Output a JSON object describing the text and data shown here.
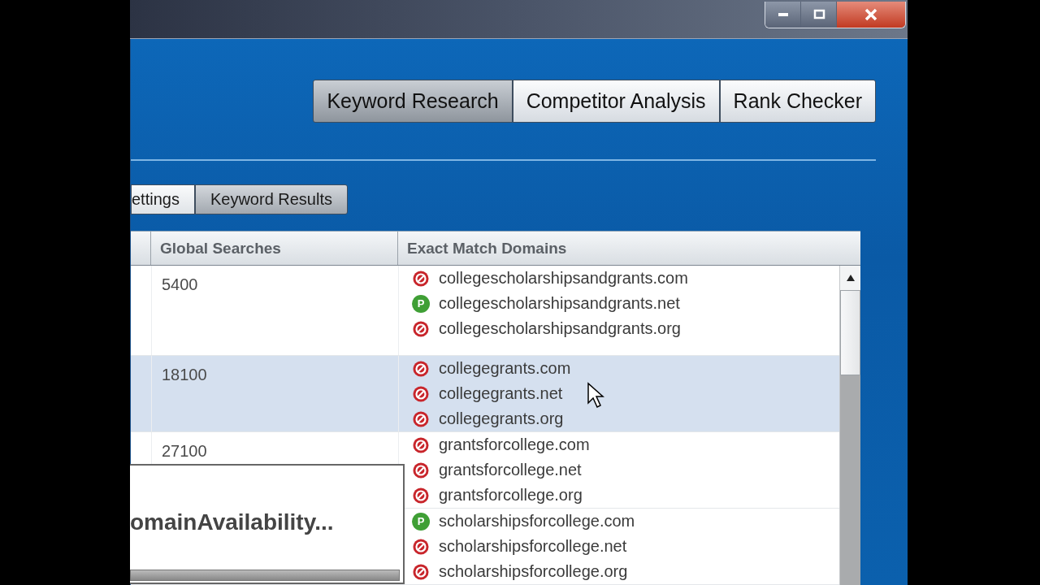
{
  "window": {
    "controls": [
      {
        "kind": "minimize"
      },
      {
        "kind": "maximize"
      },
      {
        "kind": "close"
      }
    ]
  },
  "tabs": [
    {
      "label": "Keyword Research",
      "selected": true
    },
    {
      "label": "Competitor Analysis",
      "selected": false
    },
    {
      "label": "Rank Checker",
      "selected": false
    }
  ],
  "subtabs": [
    {
      "label": "ettings",
      "selected": false
    },
    {
      "label": "Keyword Results",
      "selected": true
    }
  ],
  "table": {
    "columns": [
      "Global Searches",
      "Exact Match Domains"
    ],
    "rows": [
      {
        "selected": false,
        "searches": "5400",
        "domains": [
          {
            "name": "collegescholarshipsandgrants.com",
            "kind": "taken"
          },
          {
            "name": "collegescholarshipsandgrants.net",
            "kind": "parked",
            "badge": "P"
          },
          {
            "name": "collegescholarshipsandgrants.org",
            "kind": "taken"
          }
        ]
      },
      {
        "selected": true,
        "searches": "18100",
        "domains": [
          {
            "name": "collegegrants.com",
            "kind": "taken"
          },
          {
            "name": "collegegrants.net",
            "kind": "taken"
          },
          {
            "name": "collegegrants.org",
            "kind": "taken"
          }
        ]
      },
      {
        "selected": false,
        "searches": "27100",
        "domains": [
          {
            "name": "grantsforcollege.com",
            "kind": "taken"
          },
          {
            "name": "grantsforcollege.net",
            "kind": "taken"
          },
          {
            "name": "grantsforcollege.org",
            "kind": "taken"
          }
        ]
      },
      {
        "selected": false,
        "domains": [
          {
            "name": "scholarshipsforcollege.com",
            "kind": "parked",
            "badge": "P"
          },
          {
            "name": "scholarshipsforcollege.net",
            "kind": "taken"
          },
          {
            "name": "scholarshipsforcollege.org",
            "kind": "taken"
          }
        ]
      }
    ]
  },
  "popup": {
    "message": "omainAvailability...",
    "level": 1
  }
}
